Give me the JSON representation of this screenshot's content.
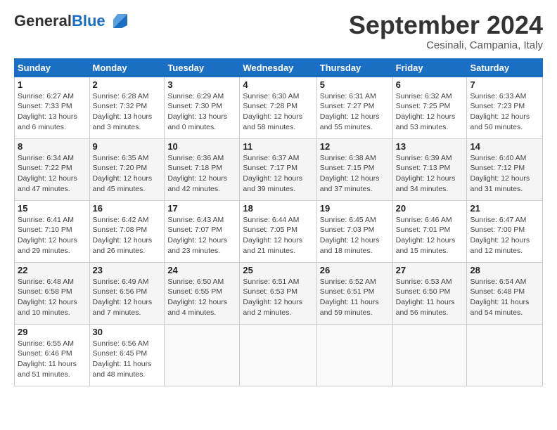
{
  "header": {
    "logo_general": "General",
    "logo_blue": "Blue",
    "month_title": "September 2024",
    "location": "Cesinali, Campania, Italy"
  },
  "weekdays": [
    "Sunday",
    "Monday",
    "Tuesday",
    "Wednesday",
    "Thursday",
    "Friday",
    "Saturday"
  ],
  "weeks": [
    [
      {
        "day": "1",
        "info": "Sunrise: 6:27 AM\nSunset: 7:33 PM\nDaylight: 13 hours and 6 minutes."
      },
      {
        "day": "2",
        "info": "Sunrise: 6:28 AM\nSunset: 7:32 PM\nDaylight: 13 hours and 3 minutes."
      },
      {
        "day": "3",
        "info": "Sunrise: 6:29 AM\nSunset: 7:30 PM\nDaylight: 13 hours and 0 minutes."
      },
      {
        "day": "4",
        "info": "Sunrise: 6:30 AM\nSunset: 7:28 PM\nDaylight: 12 hours and 58 minutes."
      },
      {
        "day": "5",
        "info": "Sunrise: 6:31 AM\nSunset: 7:27 PM\nDaylight: 12 hours and 55 minutes."
      },
      {
        "day": "6",
        "info": "Sunrise: 6:32 AM\nSunset: 7:25 PM\nDaylight: 12 hours and 53 minutes."
      },
      {
        "day": "7",
        "info": "Sunrise: 6:33 AM\nSunset: 7:23 PM\nDaylight: 12 hours and 50 minutes."
      }
    ],
    [
      {
        "day": "8",
        "info": "Sunrise: 6:34 AM\nSunset: 7:22 PM\nDaylight: 12 hours and 47 minutes."
      },
      {
        "day": "9",
        "info": "Sunrise: 6:35 AM\nSunset: 7:20 PM\nDaylight: 12 hours and 45 minutes."
      },
      {
        "day": "10",
        "info": "Sunrise: 6:36 AM\nSunset: 7:18 PM\nDaylight: 12 hours and 42 minutes."
      },
      {
        "day": "11",
        "info": "Sunrise: 6:37 AM\nSunset: 7:17 PM\nDaylight: 12 hours and 39 minutes."
      },
      {
        "day": "12",
        "info": "Sunrise: 6:38 AM\nSunset: 7:15 PM\nDaylight: 12 hours and 37 minutes."
      },
      {
        "day": "13",
        "info": "Sunrise: 6:39 AM\nSunset: 7:13 PM\nDaylight: 12 hours and 34 minutes."
      },
      {
        "day": "14",
        "info": "Sunrise: 6:40 AM\nSunset: 7:12 PM\nDaylight: 12 hours and 31 minutes."
      }
    ],
    [
      {
        "day": "15",
        "info": "Sunrise: 6:41 AM\nSunset: 7:10 PM\nDaylight: 12 hours and 29 minutes."
      },
      {
        "day": "16",
        "info": "Sunrise: 6:42 AM\nSunset: 7:08 PM\nDaylight: 12 hours and 26 minutes."
      },
      {
        "day": "17",
        "info": "Sunrise: 6:43 AM\nSunset: 7:07 PM\nDaylight: 12 hours and 23 minutes."
      },
      {
        "day": "18",
        "info": "Sunrise: 6:44 AM\nSunset: 7:05 PM\nDaylight: 12 hours and 21 minutes."
      },
      {
        "day": "19",
        "info": "Sunrise: 6:45 AM\nSunset: 7:03 PM\nDaylight: 12 hours and 18 minutes."
      },
      {
        "day": "20",
        "info": "Sunrise: 6:46 AM\nSunset: 7:01 PM\nDaylight: 12 hours and 15 minutes."
      },
      {
        "day": "21",
        "info": "Sunrise: 6:47 AM\nSunset: 7:00 PM\nDaylight: 12 hours and 12 minutes."
      }
    ],
    [
      {
        "day": "22",
        "info": "Sunrise: 6:48 AM\nSunset: 6:58 PM\nDaylight: 12 hours and 10 minutes."
      },
      {
        "day": "23",
        "info": "Sunrise: 6:49 AM\nSunset: 6:56 PM\nDaylight: 12 hours and 7 minutes."
      },
      {
        "day": "24",
        "info": "Sunrise: 6:50 AM\nSunset: 6:55 PM\nDaylight: 12 hours and 4 minutes."
      },
      {
        "day": "25",
        "info": "Sunrise: 6:51 AM\nSunset: 6:53 PM\nDaylight: 12 hours and 2 minutes."
      },
      {
        "day": "26",
        "info": "Sunrise: 6:52 AM\nSunset: 6:51 PM\nDaylight: 11 hours and 59 minutes."
      },
      {
        "day": "27",
        "info": "Sunrise: 6:53 AM\nSunset: 6:50 PM\nDaylight: 11 hours and 56 minutes."
      },
      {
        "day": "28",
        "info": "Sunrise: 6:54 AM\nSunset: 6:48 PM\nDaylight: 11 hours and 54 minutes."
      }
    ],
    [
      {
        "day": "29",
        "info": "Sunrise: 6:55 AM\nSunset: 6:46 PM\nDaylight: 11 hours and 51 minutes."
      },
      {
        "day": "30",
        "info": "Sunrise: 6:56 AM\nSunset: 6:45 PM\nDaylight: 11 hours and 48 minutes."
      },
      {
        "day": "",
        "info": ""
      },
      {
        "day": "",
        "info": ""
      },
      {
        "day": "",
        "info": ""
      },
      {
        "day": "",
        "info": ""
      },
      {
        "day": "",
        "info": ""
      }
    ]
  ]
}
